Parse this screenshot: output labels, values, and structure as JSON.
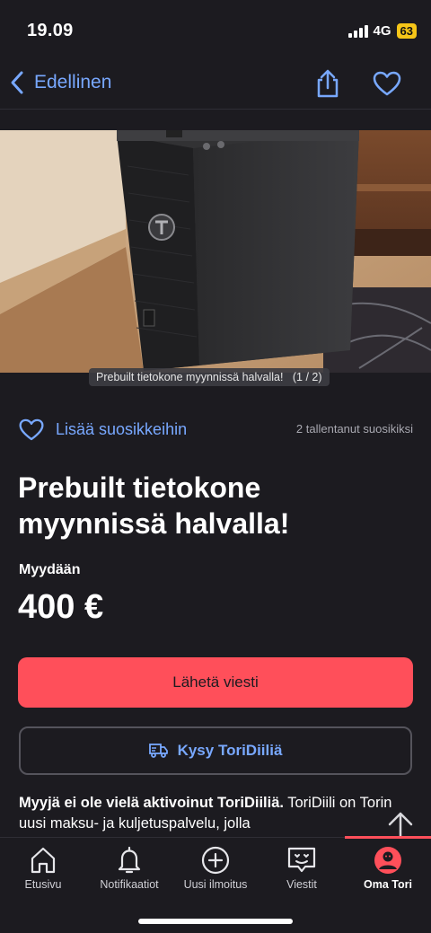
{
  "status": {
    "time": "19.09",
    "network": "4G",
    "battery": "63"
  },
  "nav": {
    "back_label": "Edellinen"
  },
  "photo": {
    "caption": "Prebuilt tietokone myynnissä halvalla!",
    "counter": "(1 / 2)"
  },
  "favorite": {
    "add_label": "Lisää suosikkeihin",
    "count_label": "2 tallentanut suosikiksi"
  },
  "listing": {
    "title": "Prebuilt tietokone myynnissä halvalla!",
    "trade_type": "Myydään",
    "price": "400 €"
  },
  "actions": {
    "send_message": "Lähetä viesti",
    "ask_toridiili": "Kysy ToriDiiliä"
  },
  "info": {
    "bold": "Myyjä ei ole vielä aktivoinut ToriDiiliä.",
    "text": " ToriDiili on Torin uusi maksu- ja kuljetuspalvelu, jolla"
  },
  "tabs": [
    {
      "label": "Etusivu",
      "icon": "home-icon"
    },
    {
      "label": "Notifikaatiot",
      "icon": "bell-icon"
    },
    {
      "label": "Uusi ilmoitus",
      "icon": "plus-circle-icon"
    },
    {
      "label": "Viestit",
      "icon": "message-icon"
    },
    {
      "label": "Oma Tori",
      "icon": "profile-avatar-icon",
      "active": true
    }
  ],
  "colors": {
    "accent": "#ff4f5a",
    "link": "#78a8ff",
    "background": "#1c1b20"
  }
}
